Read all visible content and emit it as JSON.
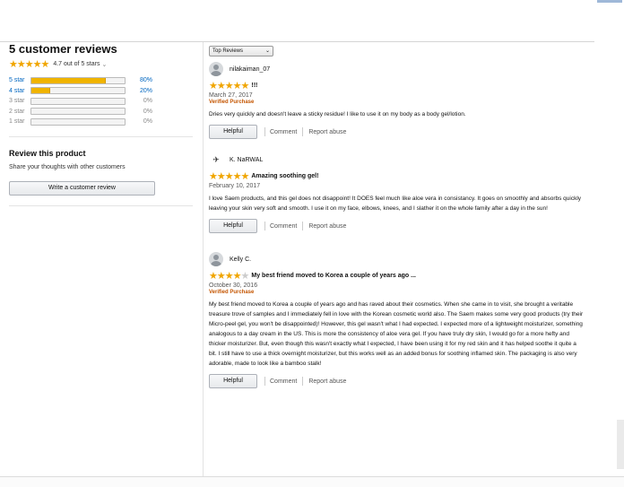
{
  "summary": {
    "title": "5 customer reviews",
    "rating_text": "4.7 out of 5 stars",
    "rating_chevron": "⌄",
    "average_rating": 4.7,
    "histogram": [
      {
        "label": "5 star",
        "pct_text": "80%",
        "fraction": 0.8
      },
      {
        "label": "4 star",
        "pct_text": "20%",
        "fraction": 0.2
      },
      {
        "label": "3 star",
        "pct_text": "0%",
        "fraction": 0
      },
      {
        "label": "2 star",
        "pct_text": "0%",
        "fraction": 0
      },
      {
        "label": "1 star",
        "pct_text": "0%",
        "fraction": 0
      }
    ],
    "star_color": "#f0a500",
    "link_color": "#0066c0"
  },
  "review_prompt": {
    "heading": "Review this product",
    "subtext": "Share your thoughts with other customers",
    "button_label": "Write a customer review"
  },
  "sort": {
    "selected": "Top Reviews",
    "chevron": "⌄"
  },
  "reviews": [
    {
      "name": "nilakaiman_07",
      "avatar_icon": "default-avatar-icon",
      "rating": 5,
      "title": "!!!",
      "date": "March 27, 2017",
      "verified": "Verified Purchase",
      "body": "Dries very quickly and doesn't leave a sticky residue! I like to use it on my body as a body gel/lotion.",
      "helpful": "Helpful",
      "comment": "Comment",
      "report": "Report abuse"
    },
    {
      "name": "K. NaRWAL",
      "avatar_icon": "custom-avatar-icon",
      "avatar_glyph": "✈",
      "rating": 5,
      "title": "Amazing soothing gel!",
      "date": "February 10, 2017",
      "verified": "",
      "body": "I love Saem products, and this gel does not disappoint! It DOES feel much like aloe vera in consistancy. It goes on smoothly and absorbs quickly leaving your skin very soft and smooth. I use it on my face, elbows, knees, and I slather it on the whole family after a day in the sun!",
      "helpful": "Helpful",
      "comment": "Comment",
      "report": "Report abuse"
    },
    {
      "name": "Kelly C.",
      "avatar_icon": "default-avatar-icon",
      "rating": 4,
      "title": "My best friend moved to Korea a couple of years ago ...",
      "date": "October 30, 2016",
      "verified": "Verified Purchase",
      "body": "My best friend moved to Korea a couple of years ago and has raved about their cosmetics. When she came in to visit, she brought a veritable treasure trove of samples and I immediately fell in love with the Korean cosmetic world also. The Saem makes some very good products (try their Micro-peel gel, you won't be disappointed)! However, this gel wasn't what I had expected. I expected more of a lightweight moisturizer, something analogous to a day cream in the US. This is more the consistency of aloe vera gel. If you have truly dry skin, I would go for a more hefty and thicker moisturizer. But, even though this wasn't exactly what I expected, I have been using it for my red skin and it has helped soothe it quite a bit. I still have to use a thick overnight moisturizer, but this works well as an added bonus for soothing inflamed skin. The packaging is also very adorable, made to look like a bamboo stalk!",
      "helpful": "Helpful",
      "comment": "Comment",
      "report": "Report abuse"
    }
  ]
}
